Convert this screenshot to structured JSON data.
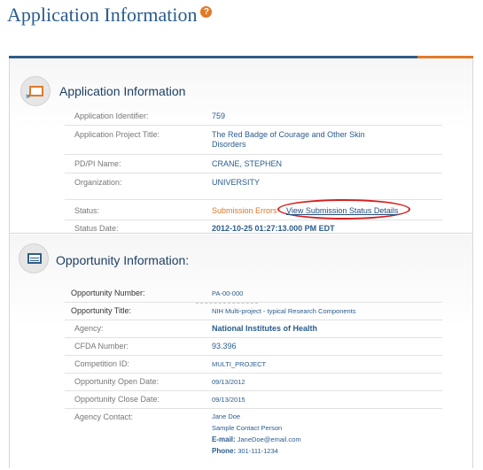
{
  "page": {
    "title": "Application Information"
  },
  "application_section": {
    "title": "Application Information",
    "fields": [
      {
        "label": "Application Identifier:",
        "value": "759"
      },
      {
        "label": "Application Project Title:",
        "value": "The Red Badge of Courage and Other Skin Disorders"
      },
      {
        "label": "PD/PI Name:",
        "value": "CRANE, STEPHEN"
      },
      {
        "label": "Organization:",
        "value": "UNIVERSITY"
      },
      {
        "label": "Status:",
        "value": "Submission Errors",
        "link": "View Submission Status Details"
      },
      {
        "label": "Status Date:",
        "value": "2012-10-25 01:27:13.000 PM EDT"
      }
    ]
  },
  "opportunity_section": {
    "title": "Opportunity Information:",
    "fields": [
      {
        "label": "Opportunity Number:",
        "value": "PA-00-000"
      },
      {
        "label": "Opportunity Title:",
        "value": "NIH Multi-project - typical Research Components"
      },
      {
        "label": "Agency:",
        "value": "National Institutes of Health"
      },
      {
        "label": "CFDA Number:",
        "value": "93.396"
      },
      {
        "label": "Competition ID:",
        "value": "MULTI_PROJECT"
      },
      {
        "label": "Opportunity Open Date:",
        "value": "09/13/2012"
      },
      {
        "label": "Opportunity Close Date:",
        "value": "09/13/2015"
      }
    ],
    "agency_contact": {
      "label": "Agency Contact:",
      "name": "Jane Doe",
      "role": "Sample Contact Person",
      "email_label": "E-mail:",
      "email": "JaneDoe@email.com",
      "phone_label": "Phone:",
      "phone": "301-111-1234"
    }
  },
  "colors": {
    "title_blue": "#2a5c8e",
    "accent_orange": "#e07b28",
    "status_error": "#d9762a",
    "highlight_red": "#d42020"
  }
}
